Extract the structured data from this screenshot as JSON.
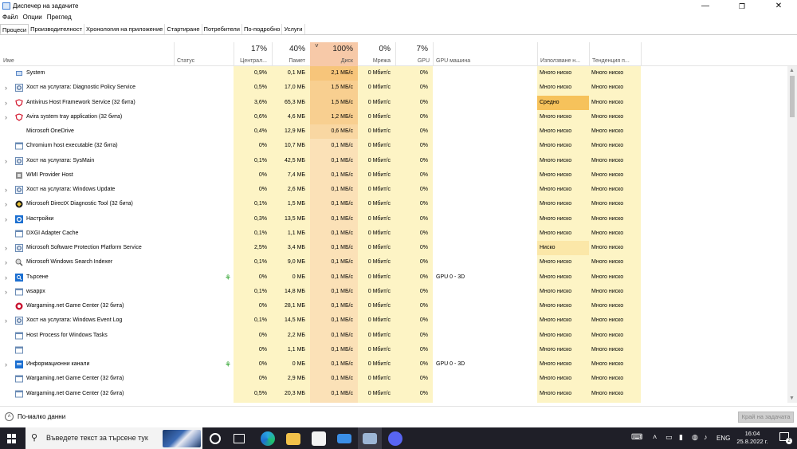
{
  "window": {
    "title": "Диспечер на задачите",
    "controls": {
      "minimize": "—",
      "maximize": "❐",
      "close": "✕"
    }
  },
  "menu": [
    "Файл",
    "Опции",
    "Преглед"
  ],
  "tabs": [
    {
      "label": "Процеси",
      "active": true
    },
    {
      "label": "Производителност",
      "active": false
    },
    {
      "label": "Хронология на приложение",
      "active": false
    },
    {
      "label": "Стартиране",
      "active": false
    },
    {
      "label": "Потребители",
      "active": false
    },
    {
      "label": "По-подробно",
      "active": false
    },
    {
      "label": "Услуги",
      "active": false
    }
  ],
  "columns": {
    "name": {
      "label": "Име"
    },
    "status": {
      "label": "Статус"
    },
    "cpu": {
      "pct": "17%",
      "label": "Централ..."
    },
    "memory": {
      "pct": "40%",
      "label": "Памет"
    },
    "disk": {
      "pct": "100%",
      "label": "Диск",
      "sort": "˅"
    },
    "network": {
      "pct": "0%",
      "label": "Мрежа"
    },
    "gpu": {
      "pct": "7%",
      "label": "GPU"
    },
    "gpu_engine": {
      "label": "GPU машина"
    },
    "power_usage": {
      "label": "Използване н..."
    },
    "power_trend": {
      "label": "Тенденция п..."
    }
  },
  "processes": [
    {
      "expand": "",
      "icon": "system-icon",
      "name": "System",
      "cpu": "0,9%",
      "mem": "0,1 МБ",
      "disk": "2,1 МБ/с",
      "disk_heat": 3,
      "net": "0 Мбит/с",
      "gpu": "0%",
      "gpu_engine": "",
      "power": "Много ниско",
      "trend": "Много ниско",
      "leaf": false
    },
    {
      "expand": "›",
      "icon": "service-host-icon",
      "name": "Хост на услугата: Diagnostic Policy Service",
      "cpu": "0,5%",
      "mem": "17,0 МБ",
      "disk": "1,5 МБ/с",
      "disk_heat": 2,
      "net": "0 Мбит/с",
      "gpu": "0%",
      "gpu_engine": "",
      "power": "Много ниско",
      "trend": "Много ниско",
      "leaf": false
    },
    {
      "expand": "›",
      "icon": "avira-icon",
      "name": "Antivirus Host Framework Service (32 бита)",
      "cpu": "3,6%",
      "mem": "65,3 МБ",
      "disk": "1,5 МБ/с",
      "disk_heat": 2,
      "net": "0 Мбит/с",
      "gpu": "0%",
      "gpu_engine": "",
      "power": "Средно",
      "power_level": "medium",
      "trend": "Много ниско",
      "leaf": false
    },
    {
      "expand": "›",
      "icon": "avira-icon",
      "name": "Avira system tray application (32 бита)",
      "cpu": "0,6%",
      "mem": "4,6 МБ",
      "disk": "1,2 МБ/с",
      "disk_heat": 2,
      "net": "0 Мбит/с",
      "gpu": "0%",
      "gpu_engine": "",
      "power": "Много ниско",
      "trend": "Много ниско",
      "leaf": false
    },
    {
      "expand": "",
      "icon": "",
      "name": "Microsoft OneDrive",
      "cpu": "0,4%",
      "mem": "12,9 МБ",
      "disk": "0,6 МБ/с",
      "disk_heat": 1,
      "net": "0 Мбит/с",
      "gpu": "0%",
      "gpu_engine": "",
      "power": "Много ниско",
      "trend": "Много ниско",
      "leaf": false
    },
    {
      "expand": "",
      "icon": "window-app-icon",
      "name": "Chromium host executable (32 бита)",
      "cpu": "0%",
      "mem": "10,7 МБ",
      "disk": "0,1 МБ/с",
      "disk_heat": 0,
      "net": "0 Мбит/с",
      "gpu": "0%",
      "gpu_engine": "",
      "power": "Много ниско",
      "trend": "Много ниско",
      "leaf": false
    },
    {
      "expand": "›",
      "icon": "service-host-icon",
      "name": "Хост на услугата: SysMain",
      "cpu": "0,1%",
      "mem": "42,5 МБ",
      "disk": "0,1 МБ/с",
      "disk_heat": 0,
      "net": "0 Мбит/с",
      "gpu": "0%",
      "gpu_engine": "",
      "power": "Много ниско",
      "trend": "Много ниско",
      "leaf": false
    },
    {
      "expand": "",
      "icon": "wmi-icon",
      "name": "WMI Provider Host",
      "cpu": "0%",
      "mem": "7,4 МБ",
      "disk": "0,1 МБ/с",
      "disk_heat": 0,
      "net": "0 Мбит/с",
      "gpu": "0%",
      "gpu_engine": "",
      "power": "Много ниско",
      "trend": "Много ниско",
      "leaf": false
    },
    {
      "expand": "›",
      "icon": "service-host-icon",
      "name": "Хост на услугата: Windows Update",
      "cpu": "0%",
      "mem": "2,6 МБ",
      "disk": "0,1 МБ/с",
      "disk_heat": 0,
      "net": "0 Мбит/с",
      "gpu": "0%",
      "gpu_engine": "",
      "power": "Много ниско",
      "trend": "Много ниско",
      "leaf": false
    },
    {
      "expand": "›",
      "icon": "directx-icon",
      "name": "Microsoft DirectX Diagnostic Tool (32 бита)",
      "cpu": "0,1%",
      "mem": "1,5 МБ",
      "disk": "0,1 МБ/с",
      "disk_heat": 0,
      "net": "0 Мбит/с",
      "gpu": "0%",
      "gpu_engine": "",
      "power": "Много ниско",
      "trend": "Много ниско",
      "leaf": false
    },
    {
      "expand": "›",
      "icon": "settings-gear-icon",
      "name": "Настройки",
      "cpu": "0,3%",
      "mem": "13,5 МБ",
      "disk": "0,1 МБ/с",
      "disk_heat": 0,
      "net": "0 Мбит/с",
      "gpu": "0%",
      "gpu_engine": "",
      "power": "Много ниско",
      "trend": "Много ниско",
      "leaf": false
    },
    {
      "expand": "",
      "icon": "window-app-icon",
      "name": "DXGI Adapter Cache",
      "cpu": "0,1%",
      "mem": "1,1 МБ",
      "disk": "0,1 МБ/с",
      "disk_heat": 0,
      "net": "0 Мбит/с",
      "gpu": "0%",
      "gpu_engine": "",
      "power": "Много ниско",
      "trend": "Много ниско",
      "leaf": false
    },
    {
      "expand": "›",
      "icon": "service-host-icon",
      "name": "Microsoft Software Protection Platform Service",
      "cpu": "2,5%",
      "mem": "3,4 МБ",
      "disk": "0,1 МБ/с",
      "disk_heat": 0,
      "net": "0 Мбит/с",
      "gpu": "0%",
      "gpu_engine": "",
      "power": "Ниско",
      "power_level": "low",
      "trend": "Много ниско",
      "leaf": false
    },
    {
      "expand": "›",
      "icon": "search-indexer-icon",
      "name": "Microsoft Windows Search Indexer",
      "cpu": "0,1%",
      "mem": "9,0 МБ",
      "disk": "0,1 МБ/с",
      "disk_heat": 0,
      "net": "0 Мбит/с",
      "gpu": "0%",
      "gpu_engine": "",
      "power": "Много ниско",
      "trend": "Много ниско",
      "leaf": false
    },
    {
      "expand": "›",
      "icon": "search-app-icon",
      "name": "Търсене",
      "cpu": "0%",
      "mem": "0 МБ",
      "disk": "0,1 МБ/с",
      "disk_heat": 0,
      "net": "0 Мбит/с",
      "gpu": "0%",
      "gpu_engine": "GPU 0 - 3D",
      "power": "Много ниско",
      "trend": "Много ниско",
      "leaf": true
    },
    {
      "expand": "›",
      "icon": "window-app-icon",
      "name": "wsappx",
      "cpu": "0,1%",
      "mem": "14,8 МБ",
      "disk": "0,1 МБ/с",
      "disk_heat": 0,
      "net": "0 Мбит/с",
      "gpu": "0%",
      "gpu_engine": "",
      "power": "Много ниско",
      "trend": "Много ниско",
      "leaf": false
    },
    {
      "expand": "",
      "icon": "wargaming-icon",
      "name": "Wargaming.net Game Center (32 бита)",
      "cpu": "0%",
      "mem": "28,1 МБ",
      "disk": "0,1 МБ/с",
      "disk_heat": 0,
      "net": "0 Мбит/с",
      "gpu": "0%",
      "gpu_engine": "",
      "power": "Много ниско",
      "trend": "Много ниско",
      "leaf": false
    },
    {
      "expand": "›",
      "icon": "service-host-icon",
      "name": "Хост на услугата: Windows Event Log",
      "cpu": "0,1%",
      "mem": "14,5 МБ",
      "disk": "0,1 МБ/с",
      "disk_heat": 0,
      "net": "0 Мбит/с",
      "gpu": "0%",
      "gpu_engine": "",
      "power": "Много ниско",
      "trend": "Много ниско",
      "leaf": false
    },
    {
      "expand": "",
      "icon": "window-app-icon",
      "name": "Host Process for Windows Tasks",
      "cpu": "0%",
      "mem": "2,2 МБ",
      "disk": "0,1 МБ/с",
      "disk_heat": 0,
      "net": "0 Мбит/с",
      "gpu": "0%",
      "gpu_engine": "",
      "power": "Много ниско",
      "trend": "Много ниско",
      "leaf": false
    },
    {
      "expand": "",
      "icon": "window-app-icon",
      "name": "",
      "cpu": "0%",
      "mem": "1,1 МБ",
      "disk": "0,1 МБ/с",
      "disk_heat": 0,
      "net": "0 Мбит/с",
      "gpu": "0%",
      "gpu_engine": "",
      "power": "Много ниско",
      "trend": "Много ниско",
      "leaf": false
    },
    {
      "expand": "›",
      "icon": "news-app-icon",
      "name": "Информационни канали",
      "cpu": "0%",
      "mem": "0 МБ",
      "disk": "0,1 МБ/с",
      "disk_heat": 0,
      "net": "0 Мбит/с",
      "gpu": "0%",
      "gpu_engine": "GPU 0 - 3D",
      "power": "Много ниско",
      "trend": "Много ниско",
      "leaf": true
    },
    {
      "expand": "",
      "icon": "window-app-icon",
      "name": "Wargaming.net Game Center (32 бита)",
      "cpu": "0%",
      "mem": "2,9 МБ",
      "disk": "0,1 МБ/с",
      "disk_heat": 0,
      "net": "0 Мбит/с",
      "gpu": "0%",
      "gpu_engine": "",
      "power": "Много ниско",
      "trend": "Много ниско",
      "leaf": false
    },
    {
      "expand": "",
      "icon": "window-app-icon",
      "name": "Wargaming.net Game Center (32 бита)",
      "cpu": "0,5%",
      "mem": "20,3 МБ",
      "disk": "0,1 МБ/с",
      "disk_heat": 0,
      "net": "0 Мбит/с",
      "gpu": "0%",
      "gpu_engine": "",
      "power": "Много ниско",
      "trend": "Много ниско",
      "leaf": false
    }
  ],
  "footer": {
    "fewer_details": "По-малко данни",
    "end_task": "Край на задачата"
  },
  "taskbar": {
    "search_placeholder": "Въведете текст за търсене тук",
    "language": "ENG",
    "time": "16:04",
    "date": "25.8.2022 г.",
    "notifications": "2"
  },
  "colors": {
    "cpu_mem_bg": "#fdf4c5",
    "disk_bg": "#fbe1b7",
    "disk_header": "#f7c9a8",
    "disk_heat_1": "#f9d7a2",
    "disk_heat_2": "#f8cf90",
    "disk_heat_3": "#f7c57a",
    "power_medium": "#f6c25b",
    "power_low": "#fbe7a8",
    "power_bg": "#fdf4c5"
  }
}
